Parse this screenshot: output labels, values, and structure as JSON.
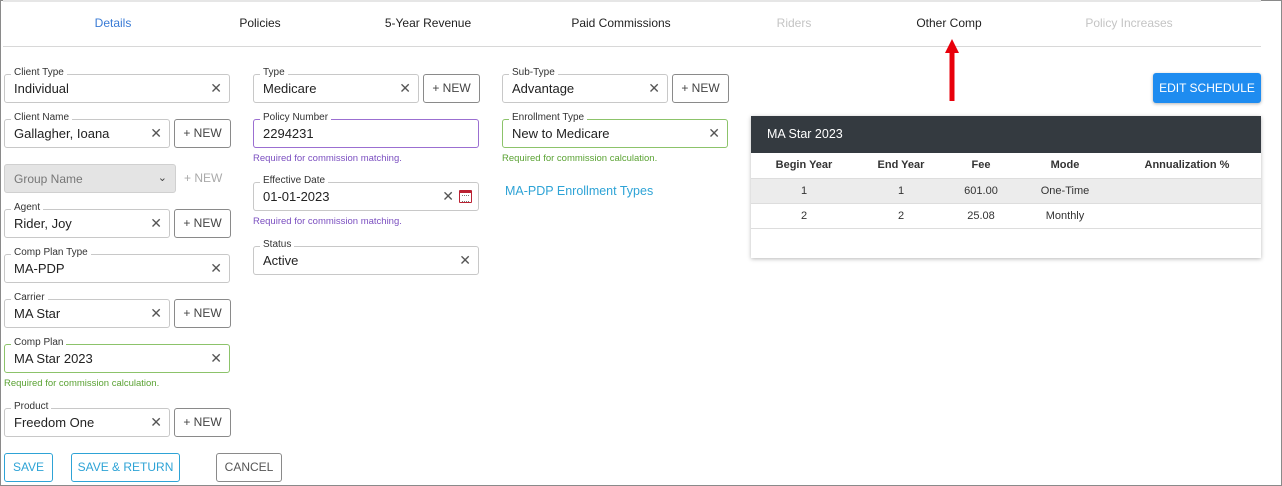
{
  "tabs": [
    {
      "label": "Details",
      "state": "active"
    },
    {
      "label": "Policies",
      "state": "normal"
    },
    {
      "label": "5-Year Revenue",
      "state": "normal"
    },
    {
      "label": "Paid Commissions",
      "state": "normal"
    },
    {
      "label": "Riders",
      "state": "disabled"
    },
    {
      "label": "Other Comp",
      "state": "normal"
    },
    {
      "label": "Policy Increases",
      "state": "disabled"
    }
  ],
  "left": {
    "client_type": {
      "label": "Client Type",
      "value": "Individual"
    },
    "client_name": {
      "label": "Client Name",
      "value": "Gallagher, Ioana",
      "new": "+ NEW"
    },
    "group_name": {
      "placeholder": "Group Name",
      "new": "+ NEW"
    },
    "agent": {
      "label": "Agent",
      "value": "Rider, Joy",
      "new": "+ NEW"
    },
    "comp_plan_type": {
      "label": "Comp Plan Type",
      "value": "MA-PDP"
    },
    "carrier": {
      "label": "Carrier",
      "value": "MA Star",
      "new": "+ NEW"
    },
    "comp_plan": {
      "label": "Comp Plan",
      "value": "MA Star 2023",
      "hint": "Required for commission calculation."
    },
    "product": {
      "label": "Product",
      "value": "Freedom One",
      "new": "+ NEW"
    }
  },
  "middle": {
    "type": {
      "label": "Type",
      "value": "Medicare",
      "new": "+ NEW"
    },
    "policy_number": {
      "label": "Policy Number",
      "value": "2294231",
      "hint": "Required for commission matching."
    },
    "effective_date": {
      "label": "Effective Date",
      "value": "01-01-2023",
      "hint": "Required for commission matching."
    },
    "status": {
      "label": "Status",
      "value": "Active"
    }
  },
  "right": {
    "sub_type": {
      "label": "Sub-Type",
      "value": "Advantage",
      "new": "+ NEW"
    },
    "enrollment_type": {
      "label": "Enrollment Type",
      "value": "New to Medicare",
      "hint": "Required for commission calculation."
    },
    "enrollment_link": "MA-PDP Enrollment Types"
  },
  "schedule": {
    "edit_button": "EDIT SCHEDULE",
    "title": "MA Star 2023",
    "columns": [
      "Begin Year",
      "End Year",
      "Fee",
      "Mode",
      "Annualization %"
    ],
    "rows": [
      [
        "1",
        "1",
        "601.00",
        "One-Time",
        ""
      ],
      [
        "2",
        "2",
        "25.08",
        "Monthly",
        ""
      ]
    ]
  },
  "footer": {
    "save": "SAVE",
    "save_return": "SAVE & RETURN",
    "cancel": "CANCEL"
  },
  "glyphs": {
    "clear": "✕",
    "chevron": "⌄"
  },
  "colors": {
    "accent": "#1e8cf0",
    "link": "#2ea3d6",
    "valid": "#8cc36a",
    "purple": "#9b6fd1",
    "arrow": "#e8000b",
    "table_header": "#343a40"
  }
}
